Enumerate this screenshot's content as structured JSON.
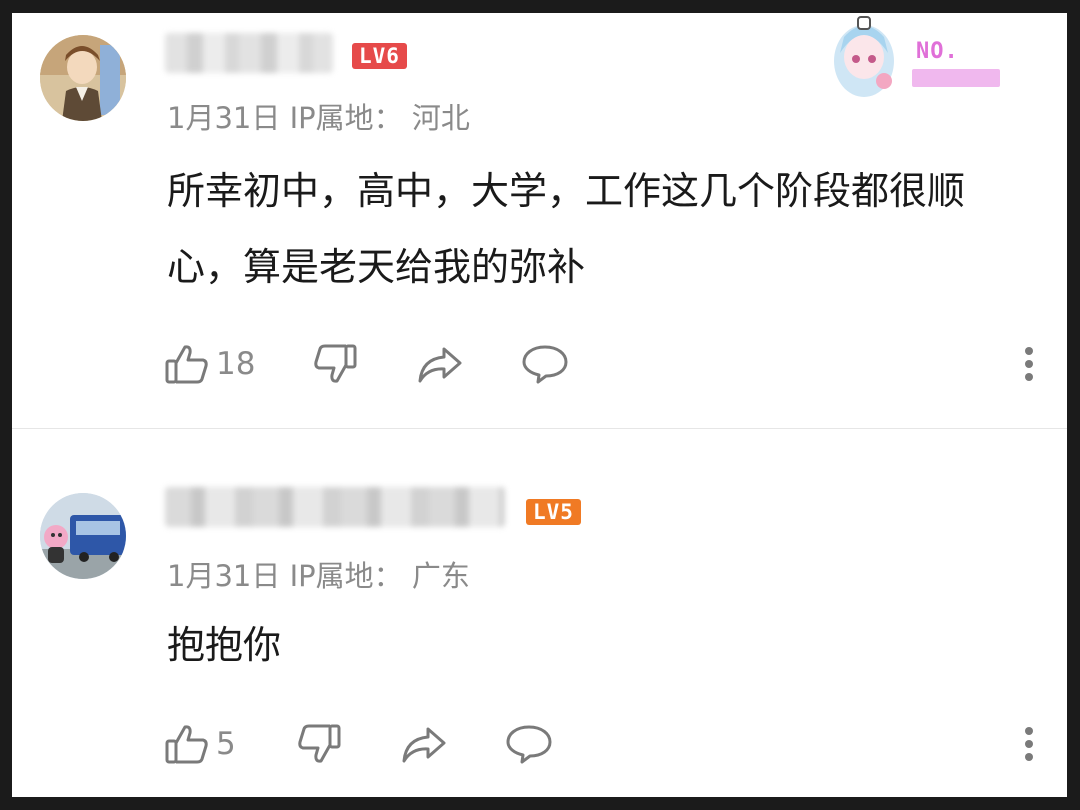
{
  "comments": [
    {
      "level": "LV6",
      "date": "1月31日",
      "ip_label": "IP属地：",
      "ip_location": "河北",
      "text": "所幸初中，高中，大学，工作这几个阶段都很顺心，算是老天给我的弥补",
      "likes": "18",
      "badge_label": "NO."
    },
    {
      "level": "LV5",
      "date": "1月31日",
      "ip_label": "IP属地：",
      "ip_location": "广东",
      "text": "抱抱你",
      "likes": "5"
    }
  ],
  "colors": {
    "lv6": "#e64a4a",
    "lv5": "#f07a24",
    "meta_text": "#8a8a8a",
    "badge_pink": "#e070d8"
  },
  "icons": [
    "thumbs-up-icon",
    "thumbs-down-icon",
    "share-icon",
    "comment-icon",
    "more-icon"
  ]
}
